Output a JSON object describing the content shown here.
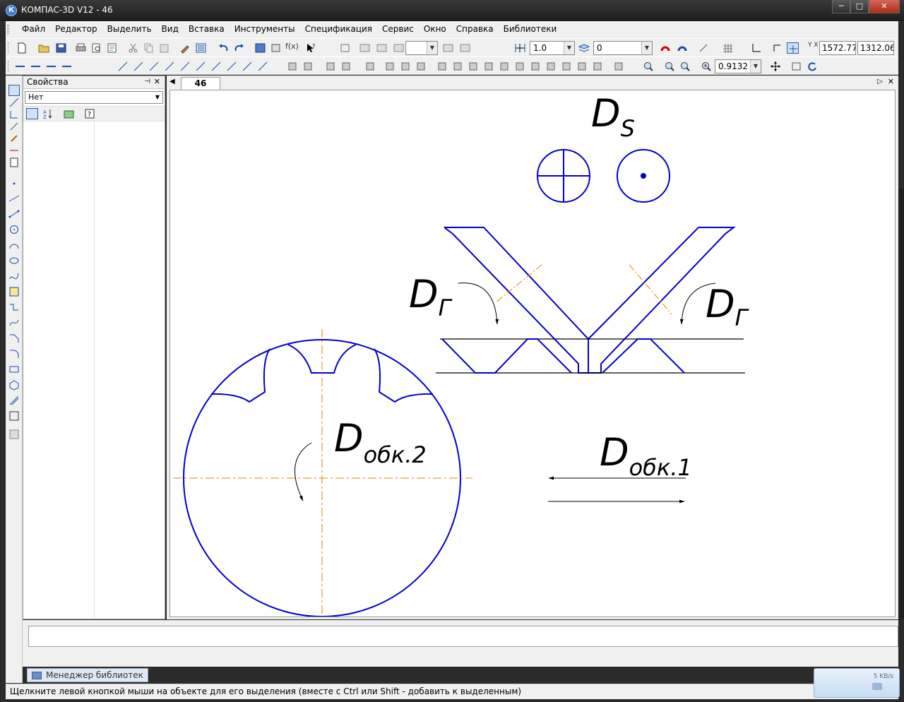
{
  "window": {
    "title": "КОМПАС-3D V12 - 46",
    "app_icon_letter": "К",
    "minimize_glyph": "─",
    "maximize_glyph": "□",
    "close_glyph": "✕"
  },
  "menu": {
    "items": [
      "Файл",
      "Редактор",
      "Выделить",
      "Вид",
      "Вставка",
      "Инструменты",
      "Спецификация",
      "Сервис",
      "Окно",
      "Справка",
      "Библиотеки"
    ]
  },
  "toolbar": {
    "line_width": "1.0",
    "layer": "0",
    "coord_x": "1572.77",
    "coord_y": "1312.06",
    "coord_label": "Y X",
    "zoom": "0.9132",
    "fx_label": "f(x)"
  },
  "properties_panel": {
    "title": "Свойства",
    "pin_glyph": "⊣",
    "close_glyph": "✕",
    "selection": "Нет",
    "dropdown_glyph": "▼"
  },
  "document": {
    "tab_label": "46",
    "nav_left": "◀",
    "nav_right": "▷",
    "close_glyph": "✕"
  },
  "drawing": {
    "label_ds_main": "D",
    "label_ds_sub": "S",
    "label_dg_left_main": "D",
    "label_dg_left_sub": "Г",
    "label_dg_right_main": "D",
    "label_dg_right_sub": "Г",
    "label_dobk2_main": "D",
    "label_dobk2_sub": "обк.2",
    "label_dobk1_main": "D",
    "label_dobk1_sub": "обк.1",
    "line_color": "#0000cc",
    "axis_color": "#e08a00"
  },
  "library_manager": {
    "tab_label": "Менеджер библиотек"
  },
  "status": {
    "hint": "Щелкните левой кнопкой мыши на объекте для его выделения (вместе с Ctrl или Shift - добавить к выделенным)"
  },
  "network_widget": {
    "speed": "5 KB/s"
  }
}
